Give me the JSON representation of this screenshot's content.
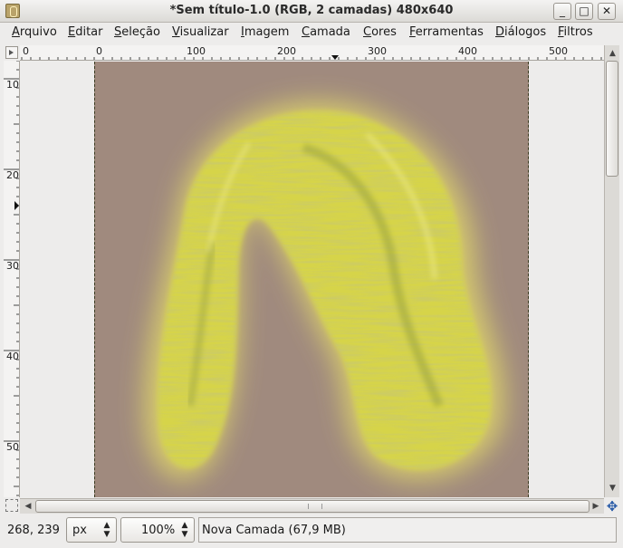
{
  "window": {
    "title": "*Sem título-1.0 (RGB, 2 camadas) 480x640",
    "app_icon": "gimp-wilber-icon",
    "controls": {
      "minimize": "_",
      "maximize": "□",
      "close": "✕"
    }
  },
  "menu": [
    {
      "label": "Arquivo",
      "underline": "A",
      "rest": "rquivo"
    },
    {
      "label": "Editar",
      "underline": "E",
      "rest": "ditar"
    },
    {
      "label": "Seleção",
      "underline": "S",
      "rest": "eleção"
    },
    {
      "label": "Visualizar",
      "underline": "V",
      "rest": "isualizar"
    },
    {
      "label": "Imagem",
      "underline": "I",
      "rest": "magem"
    },
    {
      "label": "Camada",
      "underline": "C",
      "rest": "amada"
    },
    {
      "label": "Cores",
      "underline": "C",
      "rest": "ores"
    },
    {
      "label": "Ferramentas",
      "underline": "F",
      "rest": "erramentas"
    },
    {
      "label": "Diálogos",
      "underline": "D",
      "rest": "iálogos"
    },
    {
      "label": "Filtros",
      "underline": "F",
      "rest": "iltros"
    }
  ],
  "rulers": {
    "horizontal_labels": [
      "0",
      "0",
      "100",
      "200",
      "300",
      "400",
      "500"
    ],
    "vertical_labels": [
      "100",
      "200",
      "300",
      "400",
      "500"
    ]
  },
  "canvas": {
    "image_background": "#a08a7e",
    "hair_color": "#d8d84a",
    "content": "yellow-hair-drawing"
  },
  "statusbar": {
    "coordinates": "268, 239",
    "unit": "px",
    "zoom": "100%",
    "message": "Nova Camada (67,9 MB)"
  }
}
